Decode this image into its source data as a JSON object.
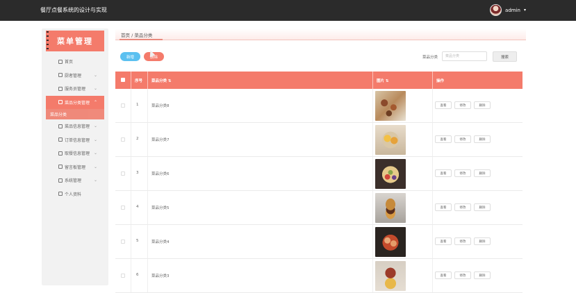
{
  "app": {
    "title": "餐厅点餐系统的设计与实现"
  },
  "user": {
    "name": "admin",
    "caret": "▾"
  },
  "sidebar": {
    "logo": "菜单管理",
    "items": [
      {
        "label": "首页",
        "icon": "home-icon",
        "chevron": ""
      },
      {
        "label": "厨者管理",
        "icon": "grid-icon",
        "chevron": "⌄"
      },
      {
        "label": "服务员管理",
        "icon": "grid-icon",
        "chevron": "⌄"
      },
      {
        "label": "菜品分类管理",
        "icon": "grid-icon",
        "chevron": "⌃",
        "active": true
      },
      {
        "label": "菜品分类",
        "sub": true
      },
      {
        "label": "菜品信息管理",
        "icon": "grid-icon",
        "chevron": "⌄"
      },
      {
        "label": "订单信息管理",
        "icon": "grid-icon",
        "chevron": "⌄"
      },
      {
        "label": "取餐信息管理",
        "icon": "grid-icon",
        "chevron": "⌄"
      },
      {
        "label": "留言板管理",
        "icon": "grid-icon",
        "chevron": "⌄"
      },
      {
        "label": "系统管理",
        "icon": "gear-icon",
        "chevron": "⌄"
      },
      {
        "label": "个人资料",
        "icon": "user-icon",
        "chevron": "⌄"
      }
    ]
  },
  "breadcrumb": "首页 / 菜品分类",
  "toolbar": {
    "add": "新增",
    "delete": "删除",
    "search_label": "菜品分类",
    "search_placeholder": "菜品分类",
    "search_button": "搜索"
  },
  "table": {
    "headers": {
      "index": "序号",
      "category": "菜品分类 ⇅",
      "image": "图片 ⇅",
      "actions": "操作"
    },
    "rows": [
      {
        "index": "1",
        "category": "菜品分类8"
      },
      {
        "index": "2",
        "category": "菜品分类7"
      },
      {
        "index": "3",
        "category": "菜品分类6"
      },
      {
        "index": "4",
        "category": "菜品分类5"
      },
      {
        "index": "5",
        "category": "菜品分类4"
      },
      {
        "index": "6",
        "category": "菜品分类3"
      }
    ],
    "actions": {
      "view": "查看",
      "edit": "修改",
      "delete": "删除"
    }
  }
}
